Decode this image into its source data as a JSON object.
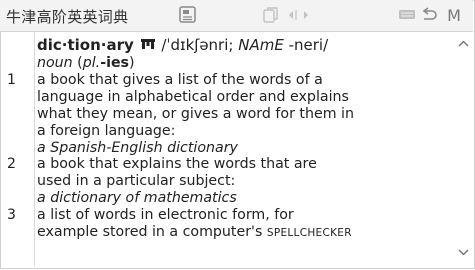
{
  "app": {
    "title": "牛津高阶英英词典"
  },
  "toolbar": {
    "icons": [
      "bookmark-icon",
      "copy-icon",
      "speaker-icon",
      "history-back-icon",
      "history-forward-icon",
      "keyboard-icon",
      "back-arrow-icon",
      "menu-icon"
    ],
    "menu_label": "M"
  },
  "entry": {
    "headword": "dic·tion·ary",
    "oxford_mark": "Oxford 3000",
    "pron_uk": "/ˈdɪkʃənri;",
    "pron_us_label": "NAmE",
    "pron_us": "-neri/",
    "pos": "noun",
    "pl_label": "(pl.",
    "plural": "-ies",
    "pl_close": ")",
    "senses": [
      {
        "num": "1",
        "lines": [
          "a book that gives a list of the words of a",
          "language in alphabetical order and explains",
          "what they mean, or gives a word for them in",
          "a foreign language:"
        ],
        "example": "a Spanish-English dictionary"
      },
      {
        "num": "2",
        "lines": [
          "a book that explains the words that are",
          "used in a particular subject:"
        ],
        "example": "a dictionary of mathematics"
      },
      {
        "num": "3",
        "lines": [
          "a list of words in electronic form, for",
          "example stored in a computer's"
        ],
        "xref": "SPELLCHECKER"
      }
    ]
  },
  "colors": {
    "toolbar_bg": "#f3f3f3",
    "text": "#222222",
    "icon": "#8a8a8a"
  }
}
